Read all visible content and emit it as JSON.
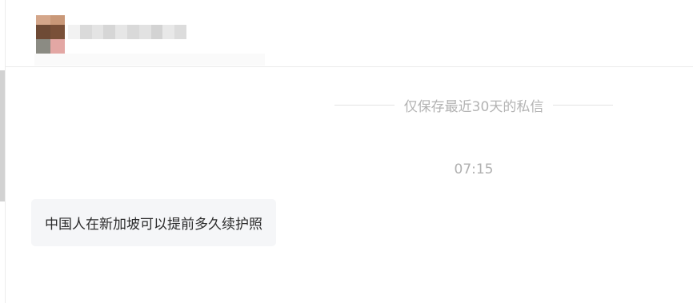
{
  "header": {
    "avatar_icon": "user-avatar-icon"
  },
  "conversation": {
    "retention_notice": "仅保存最近30天的私信",
    "timestamp": "07:15",
    "messages": [
      {
        "text": "中国人在新加坡可以提前多久续护照"
      }
    ]
  },
  "colors": {
    "bubble_background": "#f5f6f8",
    "muted_text": "#b3b3b3",
    "divider": "#ebebeb"
  }
}
